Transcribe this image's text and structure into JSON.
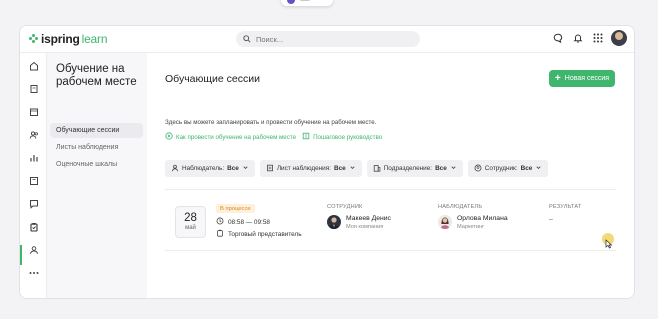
{
  "brand": {
    "name_bold": "ispring",
    "name_light": "learn",
    "accent_color": "#3fb56d"
  },
  "search": {
    "placeholder": "Поиск..."
  },
  "header_icons": [
    "chat-icon",
    "bell-icon",
    "apps-grid-icon",
    "user-avatar"
  ],
  "rail": {
    "items": [
      "home-icon",
      "book-icon",
      "calendar-icon",
      "users-icon",
      "chart-icon",
      "library-icon",
      "message-icon",
      "clipboard-icon",
      "user-search-icon",
      "more-icon"
    ],
    "active": "clipboard-icon"
  },
  "subnav": {
    "title": "Обучение на рабочем месте",
    "items": [
      {
        "label": "Обучающие сессии",
        "active": true
      },
      {
        "label": "Листы наблюдения",
        "active": false
      },
      {
        "label": "Оценочные шкалы",
        "active": false
      }
    ]
  },
  "main": {
    "title": "Обучающие сессии",
    "new_button": "Новая сессия",
    "description": "Здесь вы можете запланировать и провести обучение на рабочем месте.",
    "links": [
      {
        "label": "Как провести обучение на рабочем месте",
        "icon": "play-circle-icon"
      },
      {
        "label": "Пошаговое руководство",
        "icon": "book-icon"
      }
    ],
    "filters": [
      {
        "label": "Наблюдатель:",
        "value": "Все",
        "icon": "user-icon"
      },
      {
        "label": "Лист наблюдения:",
        "value": "Все",
        "icon": "checklist-icon"
      },
      {
        "label": "Подразделение:",
        "value": "Все",
        "icon": "building-icon"
      },
      {
        "label": "Сотрудник:",
        "value": "Все",
        "icon": "people-icon"
      }
    ]
  },
  "session": {
    "day": "28",
    "month": "май",
    "status": "В процессе",
    "status_color": "#d78a1e",
    "time": "08:58 — 09:58",
    "position": "Торговый представитель",
    "columns": {
      "employee": "СОТРУДНИК",
      "observer": "НАБЛЮДАТЕЛЬ",
      "result": "РЕЗУЛЬТАТ"
    },
    "employee": {
      "name": "Макеев Денис",
      "sub": "Моя компания"
    },
    "observer": {
      "name": "Орлова Милана",
      "sub": "Маркетинг"
    },
    "result": "–"
  }
}
